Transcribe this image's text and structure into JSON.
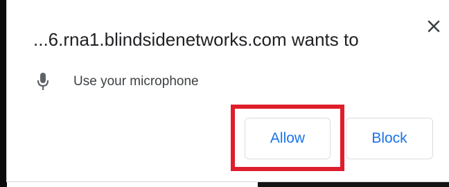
{
  "dialog": {
    "title": "...6.rna1.blindsidenetworks.com wants to",
    "close_icon": "close-icon",
    "permission": {
      "icon": "microphone-icon",
      "label": "Use your microphone"
    },
    "buttons": {
      "allow_label": "Allow",
      "block_label": "Block"
    }
  },
  "colors": {
    "button_text": "#1a73e8",
    "highlight": "#e01d2a",
    "title_text": "#202124"
  }
}
